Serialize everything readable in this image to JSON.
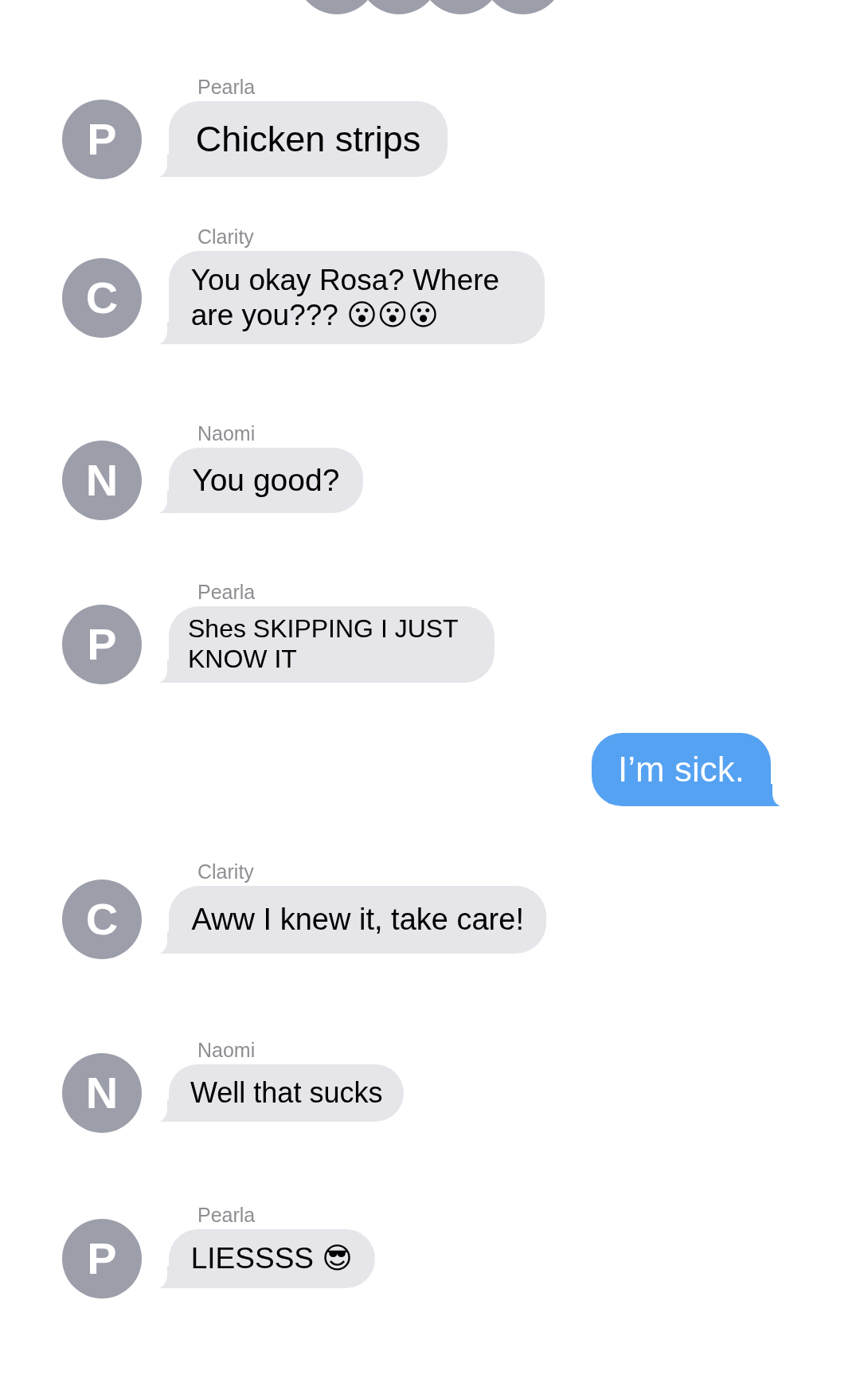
{
  "messages": [
    {
      "kind": "received",
      "sender": "Pearla",
      "initial": "P",
      "text": "Chicken strips"
    },
    {
      "kind": "received",
      "sender": "Clarity",
      "initial": "C",
      "text": "You okay Rosa? Where are you??? 😮😮😮"
    },
    {
      "kind": "received",
      "sender": "Naomi",
      "initial": "N",
      "text": "You good?"
    },
    {
      "kind": "received",
      "sender": "Pearla",
      "initial": "P",
      "text": "Shes SKIPPING I JUST KNOW IT"
    },
    {
      "kind": "sent",
      "text": "I’m sick."
    },
    {
      "kind": "received",
      "sender": "Clarity",
      "initial": "C",
      "text": "Aww I knew it, take care!"
    },
    {
      "kind": "received",
      "sender": "Naomi",
      "initial": "N",
      "text": "Well that sucks"
    },
    {
      "kind": "received",
      "sender": "Pearla",
      "initial": "P",
      "text": "LIESSSS 😎"
    }
  ]
}
